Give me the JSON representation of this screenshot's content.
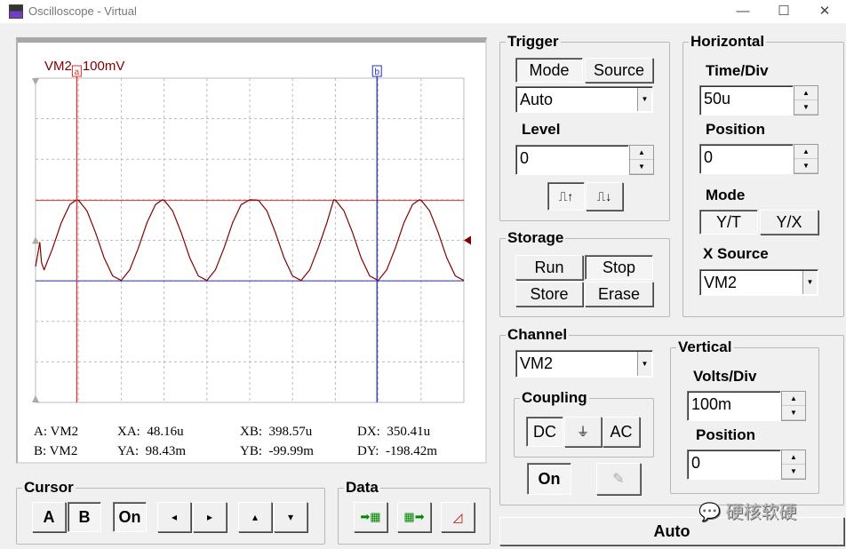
{
  "window": {
    "title": "Oscilloscope - Virtual",
    "minimize": "—",
    "maximize": "☐",
    "close": "✕"
  },
  "screen": {
    "channel_label": "VM2",
    "scale_label": "100mV",
    "cursor_a_tag": "a",
    "cursor_b_tag": "b",
    "readout": {
      "a_label": "A:",
      "a_ch": "VM2",
      "b_label": "B:",
      "b_ch": "VM2",
      "xa_label": "XA:",
      "xa": "48.16u",
      "ya_label": "YA:",
      "ya": "98.43m",
      "xb_label": "XB:",
      "xb": "398.57u",
      "yb_label": "YB:",
      "yb": "-99.99m",
      "dx_label": "DX:",
      "dx": "350.41u",
      "dy_label": "DY:",
      "dy": "-198.42m"
    }
  },
  "chart_data": {
    "type": "line",
    "xlabel": "",
    "ylabel": "",
    "x_unit": "us",
    "y_unit": "mV",
    "xlim": [
      0,
      500
    ],
    "ylim": [
      -400,
      400
    ],
    "x_divisions": 10,
    "y_divisions": 8,
    "grid": true,
    "series": [
      {
        "name": "VM2",
        "color": "#800000",
        "x": [
          0,
          5,
          7,
          10,
          20,
          30,
          40,
          48,
          50,
          60,
          70,
          80,
          90,
          100,
          110,
          120,
          130,
          140,
          148,
          150,
          160,
          170,
          180,
          190,
          200,
          210,
          220,
          230,
          240,
          250,
          260,
          270,
          280,
          290,
          300,
          310,
          320,
          330,
          340,
          348,
          350,
          360,
          370,
          380,
          390,
          400,
          410,
          420,
          430,
          440,
          448,
          450,
          460,
          470,
          480,
          490,
          500
        ],
        "y": [
          -65,
          -5,
          -55,
          -73,
          -19,
          43,
          88,
          100,
          99,
          73,
          19,
          -43,
          -88,
          -99,
          -73,
          -19,
          43,
          88,
          100,
          99,
          73,
          19,
          -43,
          -88,
          -99,
          -73,
          -19,
          43,
          88,
          100,
          99,
          73,
          19,
          -43,
          -88,
          -99,
          -73,
          -19,
          43,
          100,
          99,
          73,
          19,
          -43,
          -88,
          -99,
          -73,
          -19,
          43,
          88,
          100,
          99,
          73,
          19,
          -43,
          -88,
          -99
        ]
      }
    ],
    "cursors": {
      "a": {
        "x": 48.16,
        "y": 98.43,
        "color": "#e03030"
      },
      "b": {
        "x": 398.57,
        "y": -99.99,
        "color": "#2030c0"
      }
    }
  },
  "trigger": {
    "title": "Trigger",
    "mode": "Mode",
    "source": "Source",
    "mode_value": "Auto",
    "level_label": "Level",
    "level_value": "0"
  },
  "storage": {
    "title": "Storage",
    "run": "Run",
    "stop": "Stop",
    "store": "Store",
    "erase": "Erase"
  },
  "horizontal": {
    "title": "Horizontal",
    "timediv_label": "Time/Div",
    "timediv_value": "50u",
    "position_label": "Position",
    "position_value": "0",
    "mode_label": "Mode",
    "yt": "Y/T",
    "yx": "Y/X",
    "xsource_label": "X Source",
    "xsource_value": "VM2"
  },
  "channel": {
    "title": "Channel",
    "value": "VM2",
    "coupling_title": "Coupling",
    "dc": "DC",
    "gnd": "⏚",
    "ac": "AC",
    "on": "On"
  },
  "vertical": {
    "title": "Vertical",
    "voltsdiv_label": "Volts/Div",
    "voltsdiv_value": "100m",
    "position_label": "Position",
    "position_value": "0"
  },
  "auto": "Auto",
  "cursor": {
    "title": "Cursor",
    "a": "A",
    "b": "B",
    "on": "On",
    "left": "◂",
    "right": "▸",
    "up": "▴",
    "down": "▾"
  },
  "data": {
    "title": "Data"
  },
  "watermark": "硬核软硬"
}
